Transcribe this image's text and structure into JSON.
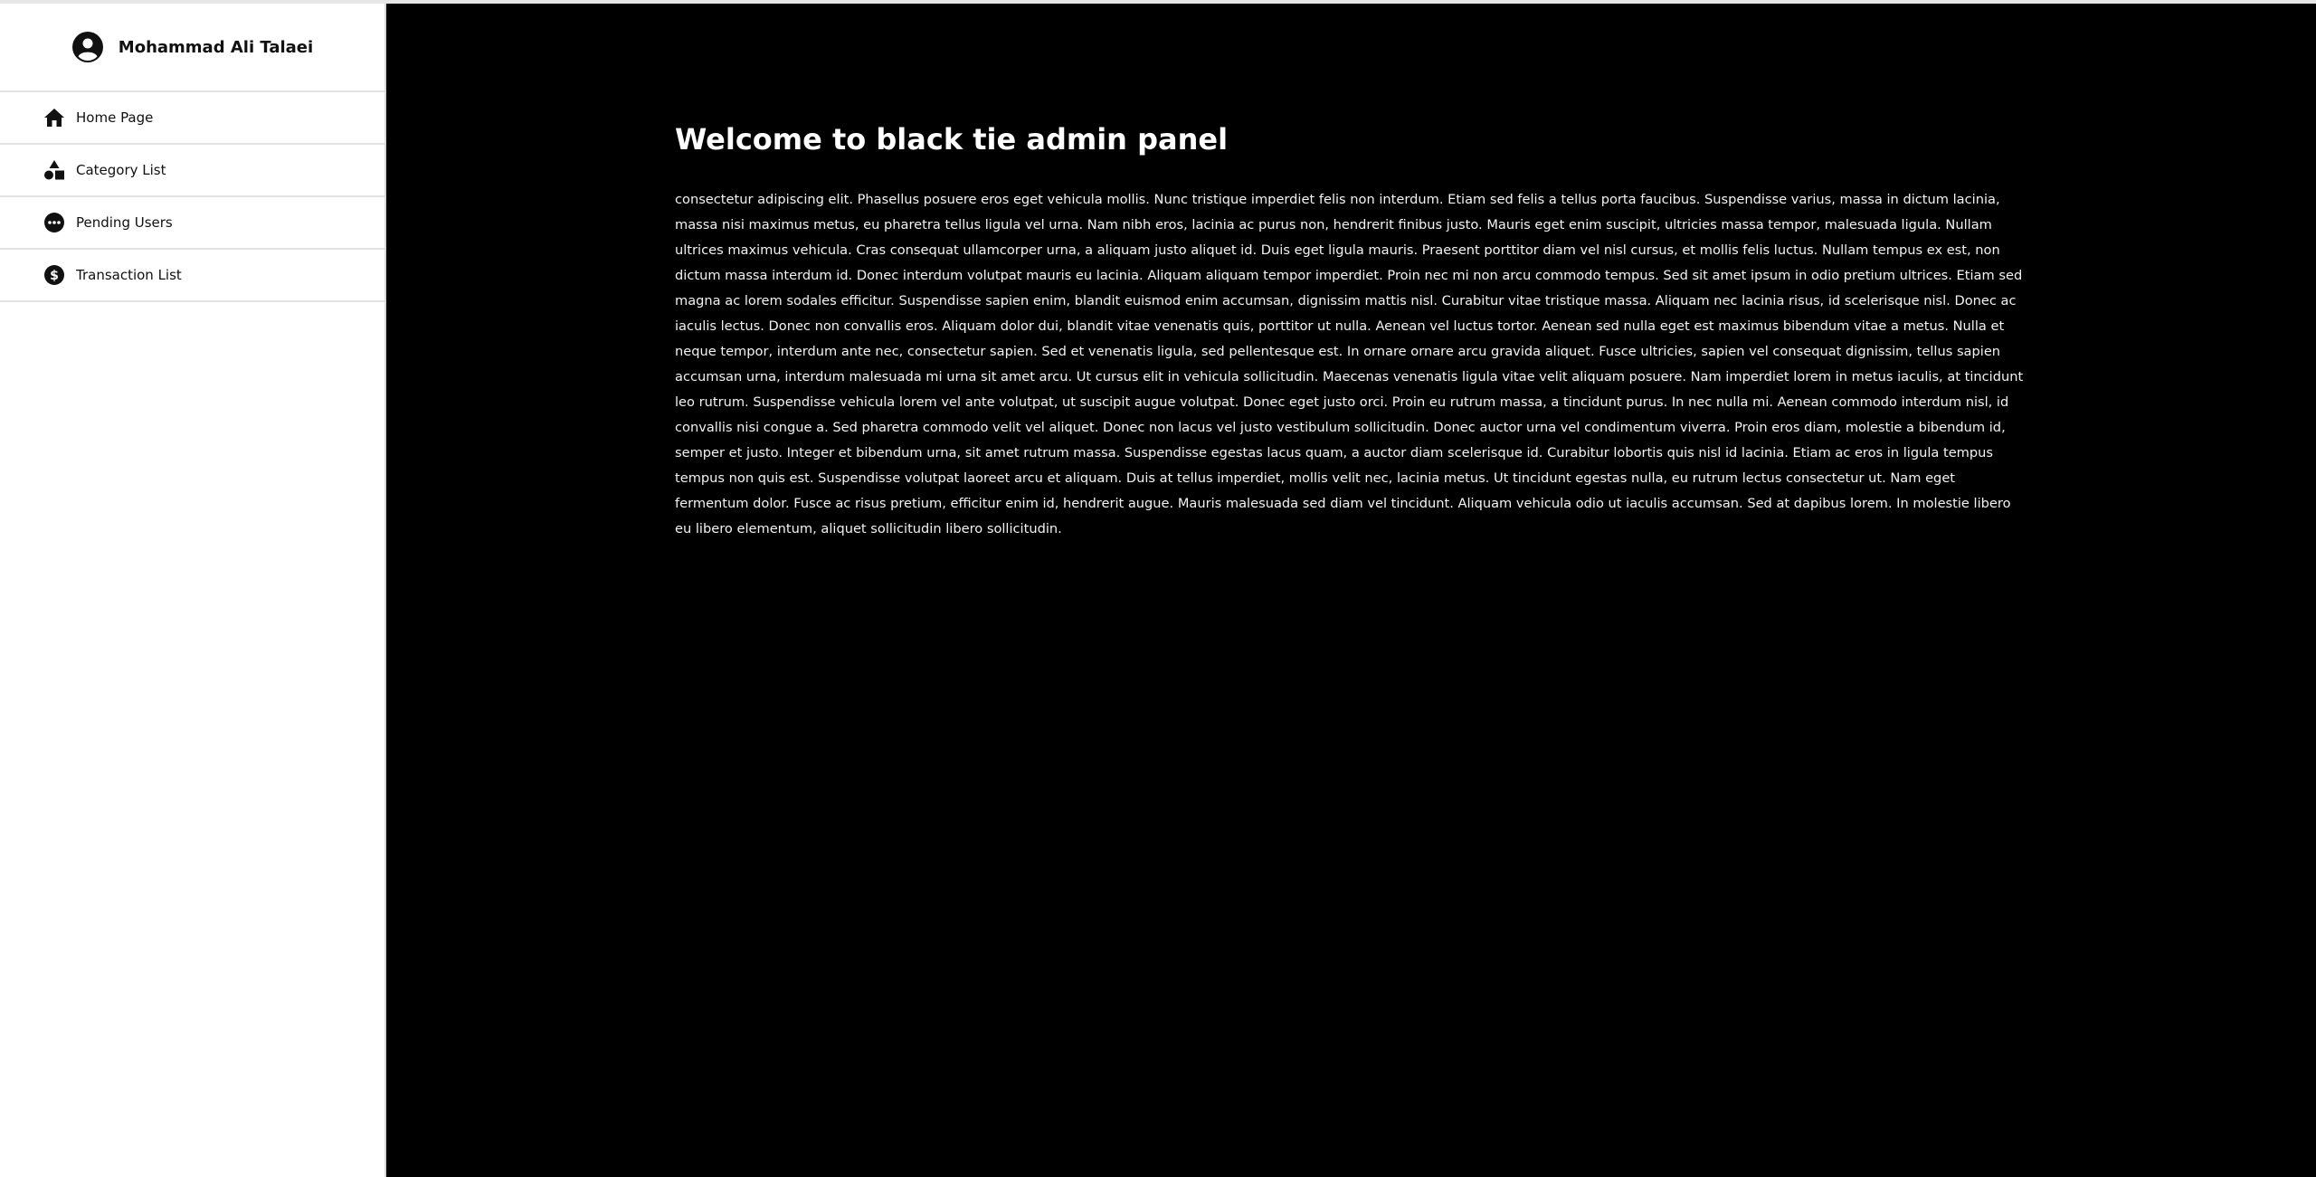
{
  "sidebar": {
    "profile_name": "Mohammad Ali Talaei",
    "items": [
      {
        "label": "Home Page",
        "icon": "home-icon"
      },
      {
        "label": "Category List",
        "icon": "shapes-icon"
      },
      {
        "label": "Pending Users",
        "icon": "ellipsis-circle-icon"
      },
      {
        "label": "Transaction List",
        "icon": "dollar-circle-icon"
      }
    ]
  },
  "main": {
    "title": "Welcome to black tie admin panel",
    "body": "consectetur adipiscing elit. Phasellus posuere eros eget vehicula mollis. Nunc tristique imperdiet felis non interdum. Etiam sed felis a tellus porta faucibus. Suspendisse varius, massa in dictum lacinia, massa nisi maximus metus, eu pharetra tellus ligula vel urna. Nam nibh eros, lacinia ac purus non, hendrerit finibus justo. Mauris eget enim suscipit, ultricies massa tempor, malesuada ligula. Nullam ultrices maximus vehicula. Cras consequat ullamcorper urna, a aliquam justo aliquet id. Duis eget ligula mauris. Praesent porttitor diam vel nisl cursus, et mollis felis luctus. Nullam tempus ex est, non dictum massa interdum id. Donec interdum volutpat mauris eu lacinia. Aliquam aliquam tempor imperdiet. Proin nec mi non arcu commodo tempus. Sed sit amet ipsum in odio pretium ultrices. Etiam sed magna ac lorem sodales efficitur. Suspendisse sapien enim, blandit euismod enim accumsan, dignissim mattis nisl. Curabitur vitae tristique massa. Aliquam nec lacinia risus, id scelerisque nisl. Donec ac iaculis lectus. Donec non convallis eros. Aliquam dolor dui, blandit vitae venenatis quis, porttitor ut nulla. Aenean vel luctus tortor. Aenean sed nulla eget est maximus bibendum vitae a metus. Nulla et neque tempor, interdum ante nec, consectetur sapien. Sed et venenatis ligula, sed pellentesque est. In ornare ornare arcu gravida aliquet. Fusce ultricies, sapien vel consequat dignissim, tellus sapien accumsan urna, interdum malesuada mi urna sit amet arcu. Ut cursus elit in vehicula sollicitudin. Maecenas venenatis ligula vitae velit aliquam posuere. Nam imperdiet lorem in metus iaculis, at tincidunt leo rutrum. Suspendisse vehicula lorem vel ante volutpat, ut suscipit augue volutpat. Donec eget justo orci. Proin eu rutrum massa, a tincidunt purus. In nec nulla mi. Aenean commodo interdum nisl, id convallis nisi congue a. Sed pharetra commodo velit vel aliquet. Donec non lacus vel justo vestibulum sollicitudin. Donec auctor urna vel condimentum viverra. Proin eros diam, molestie a bibendum id, semper et justo. Integer et bibendum urna, sit amet rutrum massa. Suspendisse egestas lacus quam, a auctor diam scelerisque id. Curabitur lobortis quis nisl id lacinia. Etiam ac eros in ligula tempus tempus non quis est. Suspendisse volutpat laoreet arcu et aliquam. Duis at tellus imperdiet, mollis velit nec, lacinia metus. Ut tincidunt egestas nulla, eu rutrum lectus consectetur ut. Nam eget fermentum dolor. Fusce ac risus pretium, efficitur enim id, hendrerit augue. Mauris malesuada sed diam vel tincidunt. Aliquam vehicula odio ut iaculis accumsan. Sed at dapibus lorem. In molestie libero eu libero elementum, aliquet sollicitudin libero sollicitudin."
  },
  "colors": {
    "sidebar_bg": "#ffffff",
    "main_bg": "#000000",
    "text_dark": "#111111",
    "text_light": "#ffffff"
  }
}
